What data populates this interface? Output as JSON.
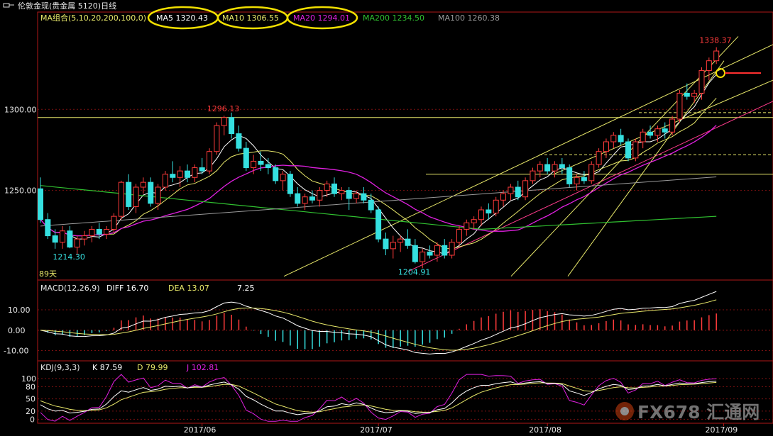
{
  "window": {
    "title": "伦敦金现(贵金属 5120)日线",
    "menu_icon": "window-menu-icon"
  },
  "colors": {
    "up": "#ff3b3b",
    "down": "#35e0e0",
    "ma5": "#ffffff",
    "ma10": "#e8e86a",
    "ma20": "#e020e0",
    "ma200": "#30c030",
    "ma100": "#9a9a9a",
    "border": "#b01818",
    "grid": "#7a1010",
    "hline": "#e8e86a"
  },
  "header": {
    "ma_label": "MA组合(5,10,20,200,100,0)",
    "ma5": "MA5 1320.43",
    "ma10": "MA10 1306.55",
    "ma20": "MA20 1294.01",
    "ma200": "MA200 1234.50",
    "ma100": "MA100 1260.38"
  },
  "macd_header": {
    "label": "MACD(12,26,9)",
    "diff": "DIFF 16.70",
    "dea": "DEA 13.07",
    "macd": "7.25"
  },
  "kdj_header": {
    "label": "KDJ(9,3,3)",
    "k": "K 87.59",
    "d": "D 79.99",
    "j": "J 102.81"
  },
  "watermark": "FX678 汇通网",
  "chart_data": [
    {
      "type": "candlestick",
      "panel": "price",
      "y_ticks": [
        "1300.00",
        "1250.00"
      ],
      "ylim": [
        1196,
        1350
      ],
      "candles": [
        [
          1251,
          1258,
          1230,
          1232
        ],
        [
          1232,
          1236,
          1220,
          1222
        ],
        [
          1222,
          1226,
          1214,
          1218
        ],
        [
          1218,
          1228,
          1214,
          1225
        ],
        [
          1225,
          1228,
          1214.3,
          1215
        ],
        [
          1215,
          1222,
          1210,
          1220
        ],
        [
          1220,
          1225,
          1216,
          1222
        ],
        [
          1222,
          1228,
          1218,
          1226
        ],
        [
          1226,
          1230,
          1220,
          1223
        ],
        [
          1223,
          1228,
          1220,
          1226
        ],
        [
          1226,
          1236,
          1224,
          1234
        ],
        [
          1234,
          1256,
          1232,
          1255
        ],
        [
          1255,
          1260,
          1238,
          1240
        ],
        [
          1240,
          1254,
          1236,
          1252
        ],
        [
          1252,
          1258,
          1248,
          1255
        ],
        [
          1255,
          1258,
          1240,
          1242
        ],
        [
          1242,
          1254,
          1238,
          1252
        ],
        [
          1252,
          1262,
          1250,
          1260
        ],
        [
          1260,
          1268,
          1255,
          1258
        ],
        [
          1258,
          1265,
          1252,
          1262
        ],
        [
          1262,
          1266,
          1255,
          1258
        ],
        [
          1258,
          1266,
          1255,
          1264
        ],
        [
          1264,
          1270,
          1260,
          1262
        ],
        [
          1262,
          1276,
          1260,
          1274
        ],
        [
          1274,
          1292,
          1272,
          1290
        ],
        [
          1290,
          1296.13,
          1284,
          1295
        ],
        [
          1295,
          1298,
          1282,
          1285
        ],
        [
          1285,
          1290,
          1274,
          1276
        ],
        [
          1276,
          1280,
          1262,
          1264
        ],
        [
          1264,
          1272,
          1260,
          1268
        ],
        [
          1268,
          1274,
          1262,
          1266
        ],
        [
          1266,
          1270,
          1260,
          1264
        ],
        [
          1264,
          1266,
          1254,
          1256
        ],
        [
          1256,
          1262,
          1250,
          1260
        ],
        [
          1260,
          1262,
          1246,
          1248
        ],
        [
          1248,
          1252,
          1240,
          1242
        ],
        [
          1242,
          1248,
          1238,
          1246
        ],
        [
          1246,
          1250,
          1242,
          1244
        ],
        [
          1244,
          1252,
          1240,
          1250
        ],
        [
          1250,
          1256,
          1246,
          1254
        ],
        [
          1254,
          1258,
          1246,
          1248
        ],
        [
          1248,
          1252,
          1244,
          1250
        ],
        [
          1250,
          1252,
          1238,
          1245
        ],
        [
          1245,
          1250,
          1242,
          1248
        ],
        [
          1248,
          1252,
          1242,
          1244
        ],
        [
          1244,
          1248,
          1236,
          1238
        ],
        [
          1238,
          1240,
          1218,
          1220
        ],
        [
          1220,
          1224,
          1210,
          1214
        ],
        [
          1214,
          1222,
          1208,
          1218
        ],
        [
          1218,
          1222,
          1212,
          1220
        ],
        [
          1220,
          1226,
          1214,
          1216
        ],
        [
          1216,
          1220,
          1204.91,
          1206
        ],
        [
          1206,
          1214,
          1202,
          1212
        ],
        [
          1212,
          1216,
          1208,
          1210
        ],
        [
          1210,
          1218,
          1206,
          1216
        ],
        [
          1216,
          1220,
          1208,
          1210
        ],
        [
          1210,
          1220,
          1208,
          1218
        ],
        [
          1218,
          1228,
          1216,
          1226
        ],
        [
          1226,
          1232,
          1222,
          1230
        ],
        [
          1230,
          1234,
          1226,
          1232
        ],
        [
          1232,
          1240,
          1228,
          1238
        ],
        [
          1238,
          1242,
          1232,
          1236
        ],
        [
          1236,
          1246,
          1234,
          1244
        ],
        [
          1244,
          1250,
          1240,
          1248
        ],
        [
          1248,
          1254,
          1244,
          1252
        ],
        [
          1252,
          1256,
          1244,
          1246
        ],
        [
          1246,
          1258,
          1244,
          1256
        ],
        [
          1256,
          1264,
          1254,
          1262
        ],
        [
          1262,
          1268,
          1258,
          1266
        ],
        [
          1266,
          1270,
          1260,
          1262
        ],
        [
          1262,
          1268,
          1258,
          1266
        ],
        [
          1266,
          1270,
          1260,
          1264
        ],
        [
          1264,
          1266,
          1252,
          1254
        ],
        [
          1254,
          1260,
          1250,
          1258
        ],
        [
          1258,
          1262,
          1254,
          1256
        ],
        [
          1256,
          1268,
          1254,
          1266
        ],
        [
          1266,
          1276,
          1264,
          1274
        ],
        [
          1274,
          1282,
          1270,
          1280
        ],
        [
          1280,
          1286,
          1276,
          1284
        ],
        [
          1284,
          1288,
          1278,
          1280
        ],
        [
          1280,
          1282,
          1268,
          1270
        ],
        [
          1270,
          1282,
          1268,
          1280
        ],
        [
          1280,
          1288,
          1276,
          1286
        ],
        [
          1286,
          1290,
          1282,
          1284
        ],
        [
          1284,
          1290,
          1280,
          1288
        ],
        [
          1288,
          1292,
          1282,
          1286
        ],
        [
          1286,
          1296,
          1284,
          1294
        ],
        [
          1294,
          1312,
          1292,
          1310
        ],
        [
          1310,
          1316,
          1306,
          1308
        ],
        [
          1308,
          1312,
          1304,
          1310
        ],
        [
          1310,
          1326,
          1306,
          1324
        ],
        [
          1324,
          1332,
          1318,
          1330
        ],
        [
          1330,
          1338.37,
          1328,
          1336
        ]
      ],
      "annotations": [
        {
          "text": "1296.13",
          "index": 25,
          "value": 1296.13,
          "color": "#ff3b3b"
        },
        {
          "text": "1214.30",
          "index": 4,
          "value": 1214.3,
          "color": "#35e0e0"
        },
        {
          "text": "1204.91",
          "index": 51,
          "value": 1204.91,
          "color": "#35e0e0"
        },
        {
          "text": "1338.37",
          "index": 92,
          "value": 1338.37,
          "color": "#ff3b3b"
        }
      ],
      "count_label": "89天",
      "x_ticks": [
        "2017/06",
        "2017/07",
        "2017/08",
        "2017/09"
      ]
    },
    {
      "type": "bar+line",
      "panel": "macd",
      "y_ticks": [
        "10.00",
        "0.00",
        "-10.00"
      ],
      "ylim": [
        -14,
        18
      ]
    },
    {
      "type": "line",
      "panel": "kdj",
      "y_ticks": [
        "100",
        "80",
        "50",
        "20",
        "0"
      ],
      "ylim": [
        -8,
        112
      ]
    }
  ]
}
